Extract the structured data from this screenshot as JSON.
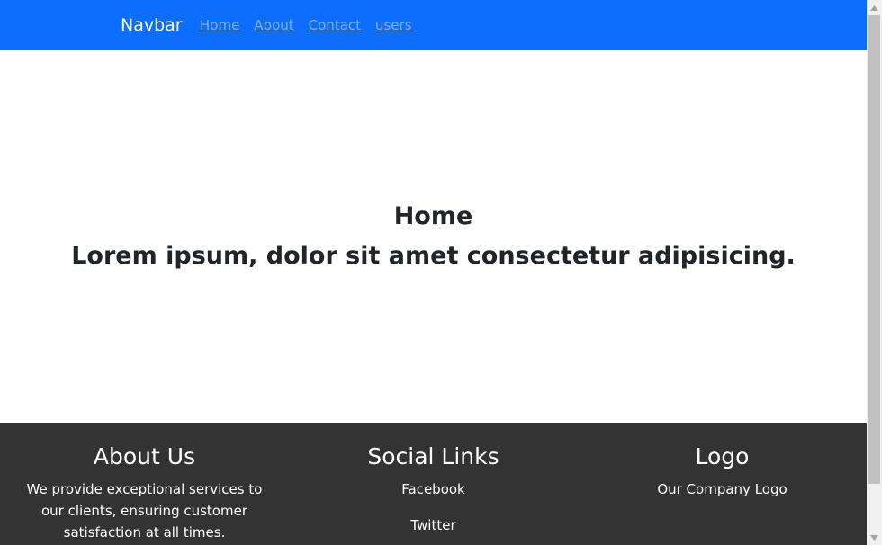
{
  "navbar": {
    "brand": "Navbar",
    "links": [
      "Home",
      "About",
      "Contact",
      "users"
    ],
    "bg_color": "#0d6efd"
  },
  "hero": {
    "title": "Home",
    "subtitle": "Lorem ipsum, dolor sit amet consectetur adipisicing."
  },
  "footer": {
    "bg_color": "#333333",
    "about": {
      "title": "About Us",
      "text": "We provide exceptional services to our clients, ensuring customer satisfaction at all times."
    },
    "social": {
      "title": "Social Links",
      "links": [
        "Facebook",
        "Twitter"
      ]
    },
    "logo": {
      "title": "Logo",
      "text": "Our Company Logo"
    }
  },
  "scrollbar": {
    "up_icon": "chevron-up-icon",
    "down_icon": "chevron-down-icon"
  }
}
